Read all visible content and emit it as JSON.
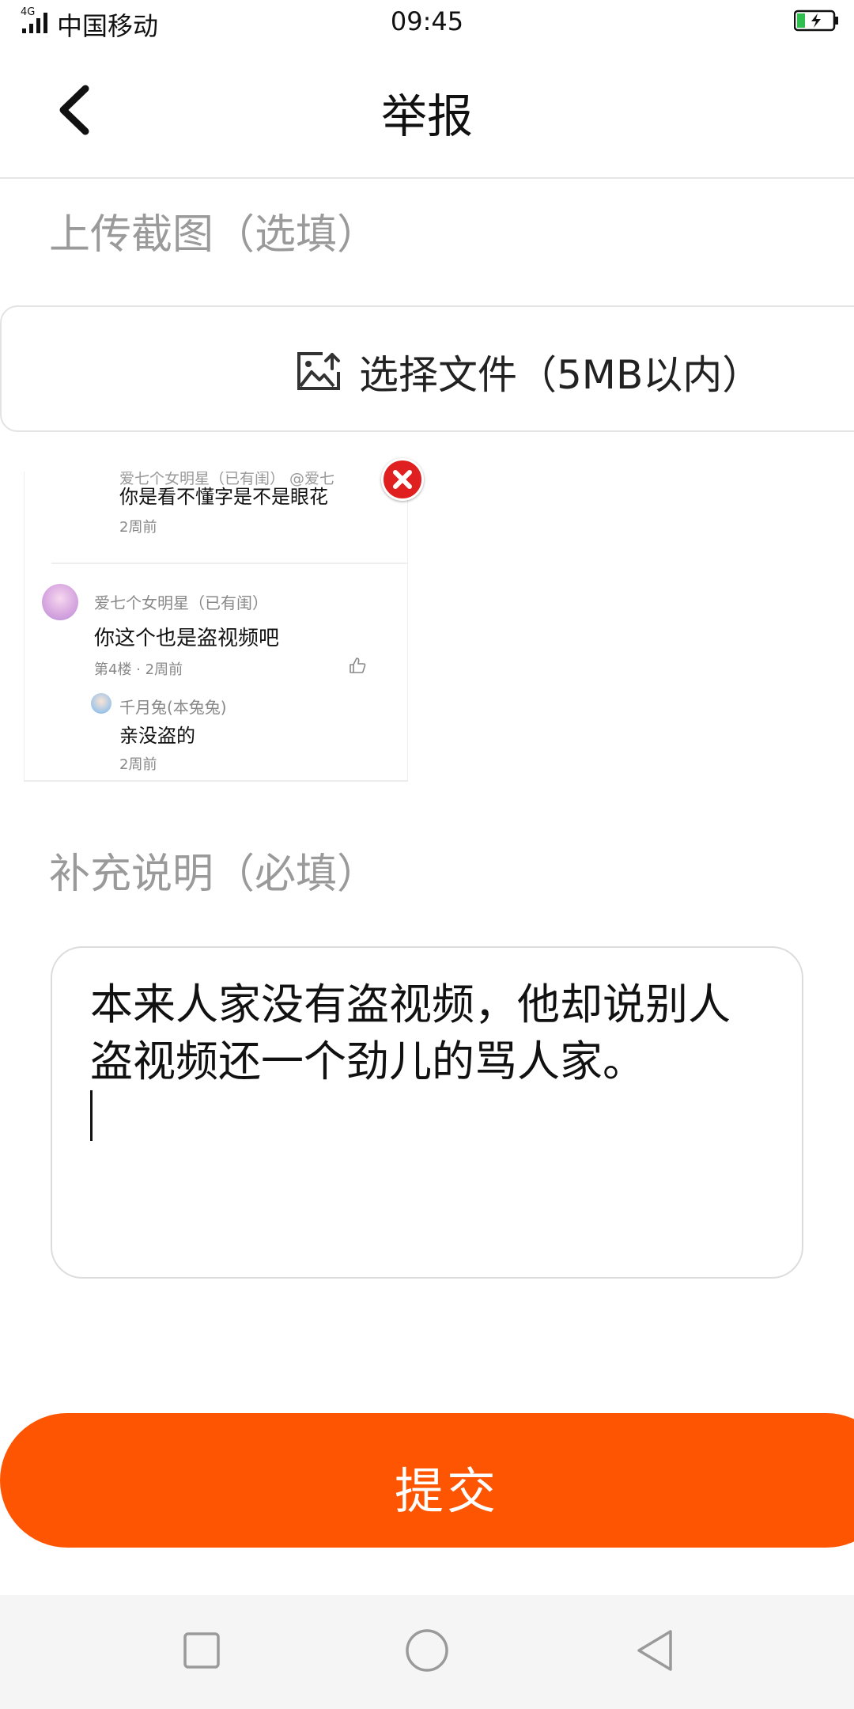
{
  "status_bar": {
    "network": "4G",
    "carrier": "中国移动",
    "time": "09:45",
    "icons": [
      "signal-icon",
      "battery-charging-icon"
    ]
  },
  "header": {
    "title": "举报",
    "back_icon": "chevron-left-icon"
  },
  "upload_section": {
    "label": "上传截图（选填）",
    "picker_icon": "image-upload-icon",
    "picker_label": "选择文件（5MB以内）"
  },
  "thumbnail": {
    "partial_header": "爱七个女明星（已有闺）   @爱七",
    "comment1_text": "你是看不懂字是不是眼花",
    "comment1_time": "2周前",
    "comment2_user": "爱七个女明星（已有闺）",
    "comment2_text": "你这个也是盗视频吧",
    "comment2_meta": "第4楼 · 2周前",
    "reply_user": "千月兔(本兔兔)",
    "reply_text": "亲没盗的",
    "reply_time": "2周前",
    "remove_icon": "close-icon"
  },
  "description_section": {
    "label": "补充说明（必填）",
    "value": "本来人家没有盗视频，他却说别人盗视频还一个劲儿的骂人家。"
  },
  "submit": {
    "label": "提交",
    "color": "#fd5502"
  },
  "nav_bar": {
    "icons": [
      "recent-apps-icon",
      "home-icon",
      "back-triangle-icon"
    ]
  }
}
